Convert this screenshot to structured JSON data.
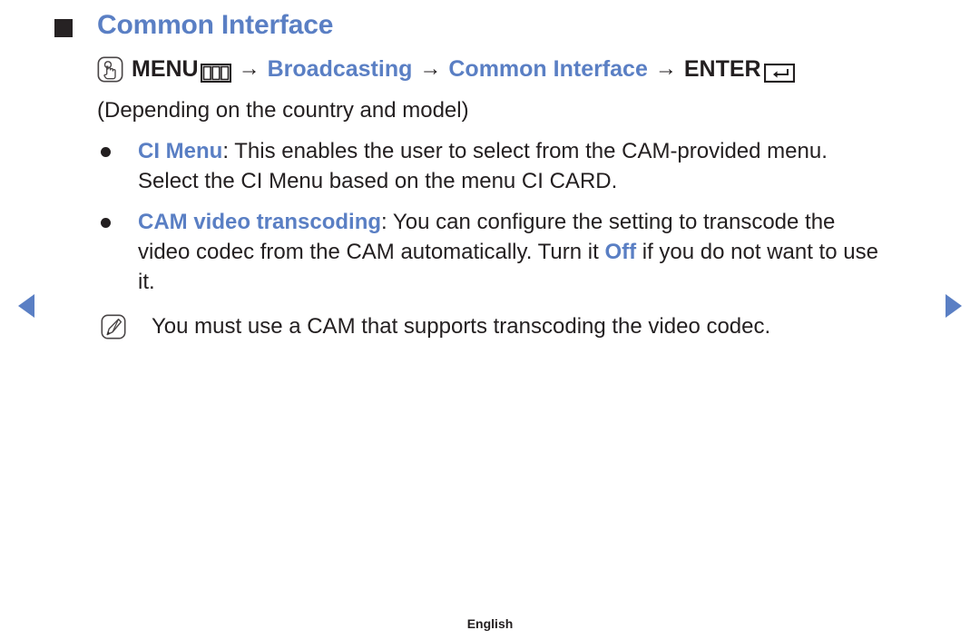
{
  "heading": {
    "text": "Common Interface",
    "bullet_icon": "square-bullet-icon",
    "color": "#5a7fc4"
  },
  "menu_path": {
    "hand_icon": "menu-hand-press-icon",
    "menu_label": "MENU",
    "grid_icon": "menu-grid-icon",
    "arrow_1": "→",
    "broadcasting_label": "Broadcasting",
    "arrow_2": "→",
    "common_interface_label": "Common Interface",
    "arrow_3": "→",
    "enter_label": "ENTER",
    "enter_icon": "enter-return-arrow-icon"
  },
  "note_country": "(Depending on the country and model)",
  "bullets": [
    {
      "keyword": "CI Menu",
      "lines": [
        {
          "segments": [
            {
              "text": "CI Menu",
              "style": "keyword"
            },
            {
              "text": ": This enables the user to select from the CAM-provided menu.",
              "style": "plain"
            }
          ]
        },
        {
          "segments": [
            {
              "text": "Select the CI Menu based on the menu CI CARD.",
              "style": "plain"
            }
          ]
        }
      ]
    },
    {
      "keyword": "CAM video transcoding",
      "lines": [
        {
          "segments": [
            {
              "text": "CAM video transcoding",
              "style": "keyword"
            },
            {
              "text": ": You can configure the setting to transcode the",
              "style": "plain"
            }
          ]
        },
        {
          "segments": [
            {
              "text": "video codec from the CAM automatically. Turn it ",
              "style": "plain"
            },
            {
              "text": "Off",
              "style": "keyword"
            },
            {
              "text": " if you do not want to use",
              "style": "plain"
            }
          ]
        },
        {
          "segments": [
            {
              "text": "it.",
              "style": "plain"
            }
          ]
        }
      ]
    }
  ],
  "note": {
    "icon": "note-pen-icon",
    "text": "You must use a CAM that supports transcoding the video codec."
  },
  "navigation": {
    "prev_icon": "prev-page-triangle-icon",
    "next_icon": "next-page-triangle-icon",
    "accent_color": "#5a7fc4"
  },
  "footer": {
    "language": "English"
  }
}
